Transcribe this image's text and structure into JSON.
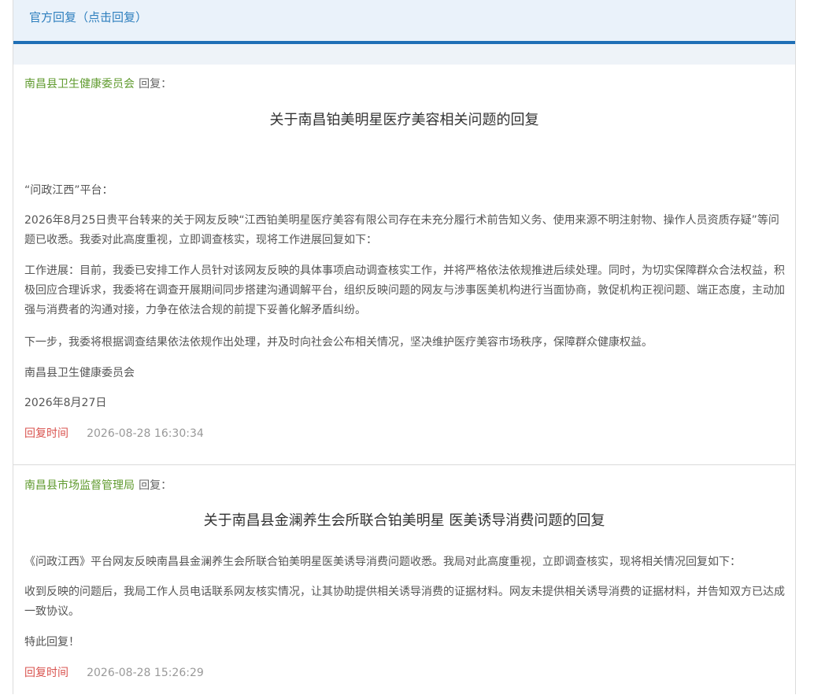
{
  "header": {
    "title": "官方回复（点击回复）"
  },
  "replies": [
    {
      "org": "南昌县卫生健康委员会",
      "org_suffix": "回复：",
      "headline": "关于南昌铂美明星医疗美容相关问题的回复",
      "paragraphs": [
        "“问政江西”平台：",
        "2026年8月25日贵平台转来的关于网友反映“江西铂美明星医疗美容有限公司存在未充分履行术前告知义务、使用来源不明注射物、操作人员资质存疑”等问题已收悉。我委对此高度重视，立即调查核实，现将工作进展回复如下：",
        "工作进展：目前，我委已安排工作人员针对该网友反映的具体事项启动调查核实工作，并将严格依法依规推进后续处理。同时，为切实保障群众合法权益，积极回应合理诉求，我委将在调查开展期间同步搭建沟通调解平台，组织反映问题的网友与涉事医美机构进行当面协商，敦促机构正视问题、端正态度，主动加强与消费者的沟通对接，力争在依法合规的前提下妥善化解矛盾纠纷。",
        "下一步，我委将根据调查结果依法依规作出处理，并及时向社会公布相关情况，坚决维护医疗美容市场秩序，保障群众健康权益。",
        "南昌县卫生健康委员会",
        "2026年8月27日"
      ],
      "time_label": "回复时间",
      "time_value": "2026-08-28 16:30:34"
    },
    {
      "org": "南昌县市场监督管理局",
      "org_suffix": "回复：",
      "headline": "关于南昌县金澜养生会所联合铂美明星 医美诱导消费问题的回复",
      "paragraphs": [
        "《问政江西》平台网友反映南昌县金澜养生会所联合铂美明星医美诱导消费问题收悉。我局对此高度重视，立即调查核实，现将相关情况回复如下：",
        "收到反映的问题后，我局工作人员电话联系网友核实情况，让其协助提供相关诱导消费的证据材料。网友未提供相关诱导消费的证据材料，并告知双方已达成一致协议。",
        "特此回复！"
      ],
      "time_label": "回复时间",
      "time_value": "2026-08-28 15:26:29"
    }
  ]
}
